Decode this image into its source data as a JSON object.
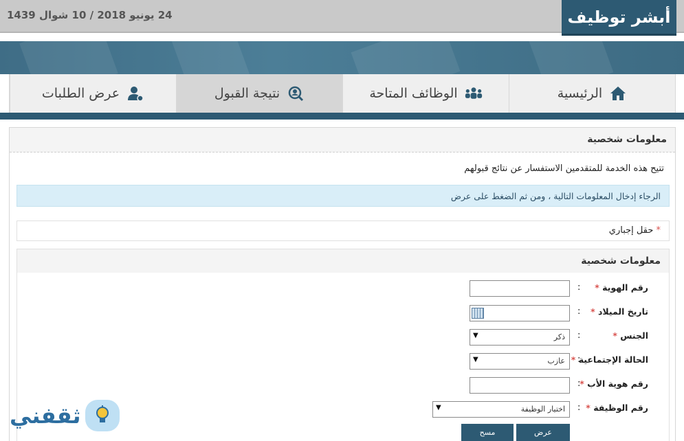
{
  "header": {
    "date": "24 يونيو 2018  /  10 شوال 1439",
    "logo_text": "أبشر توظيف"
  },
  "nav": {
    "items": [
      {
        "label": "الرئيسية",
        "icon": "home-icon"
      },
      {
        "label": "الوظائف المتاحة",
        "icon": "people-icon"
      },
      {
        "label": "نتيجة القبول",
        "icon": "search-user-icon",
        "active": true
      },
      {
        "label": "عرض الطلبات",
        "icon": "user-settings-icon"
      }
    ]
  },
  "panel": {
    "title": "معلومات شخصية",
    "description": "تتيح هذه الخدمة للمتقدمين الاستفسار عن نتائج قبولهم",
    "info": "الرجاء إدخال المعلومات التالية ، ومن ثم الضغط على عرض",
    "required_note": "حقل إجباري",
    "required_star": "*"
  },
  "form": {
    "title": "معلومات شخصية",
    "fields": [
      {
        "label": "رقم الهوية",
        "star": "*",
        "type": "text",
        "value": ""
      },
      {
        "label": "تاريخ الميلاد",
        "star": "*",
        "type": "date",
        "value": ""
      },
      {
        "label": "الجنس",
        "star": "*",
        "type": "select",
        "value": "ذكر"
      },
      {
        "label": "الحالة الإجتماعية",
        "star": "*",
        "type": "select",
        "value": "عازب"
      },
      {
        "label": "رقم هوية الأب",
        "star": "*",
        "type": "text",
        "value": ""
      },
      {
        "label": "رقم الوظيفة",
        "star": "*",
        "type": "select",
        "value": "اختيار الوظيفة"
      }
    ],
    "colon": ":",
    "submit_label": "عرض",
    "clear_label": "مسح"
  },
  "watermark": {
    "text": "ثقفني"
  },
  "colors": {
    "primary": "#2d5a73",
    "info_bg": "#d9eef8",
    "required": "#d9534f"
  }
}
